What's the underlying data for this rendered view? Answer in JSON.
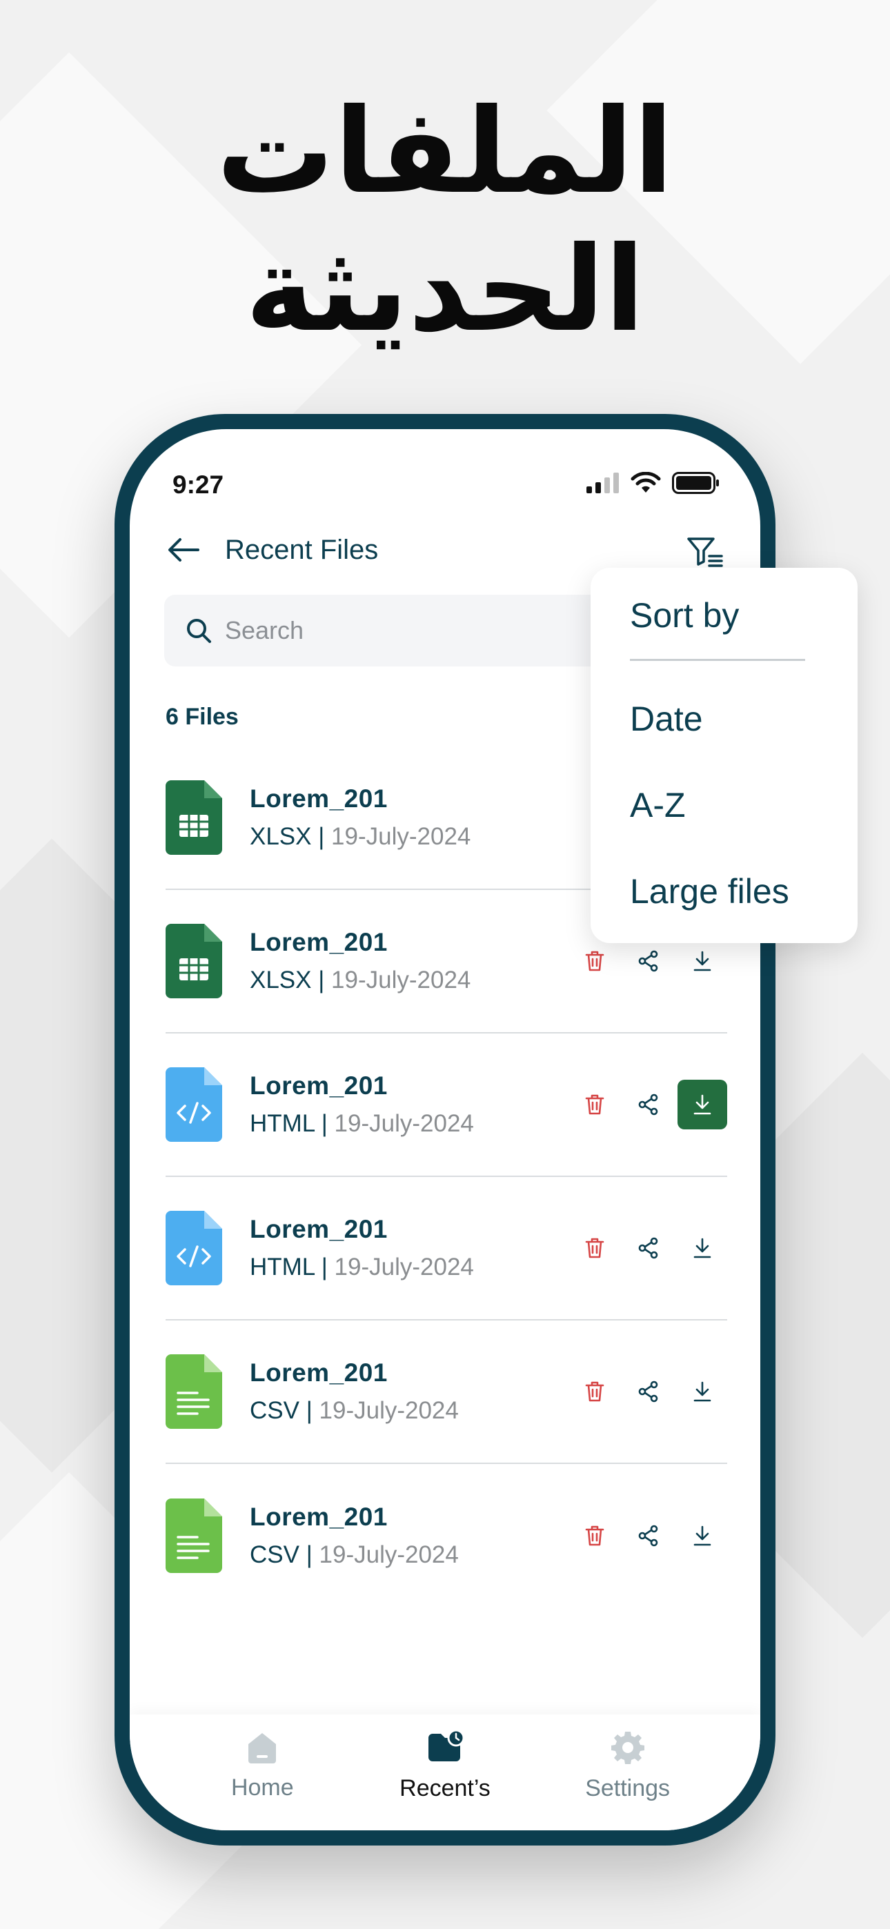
{
  "promo": {
    "headline_line1": "الملفات",
    "headline_line2": "الحديثة"
  },
  "status_bar": {
    "time": "9:27"
  },
  "header": {
    "title": "Recent Files"
  },
  "search": {
    "placeholder": "Search"
  },
  "files_count": "6 Files",
  "files": [
    {
      "name": "Lorem_201",
      "type": "XLSX",
      "separator": " | ",
      "date": "19-July-2024",
      "icon": "xlsx-file-icon",
      "color": "#217346"
    },
    {
      "name": "Lorem_201",
      "type": "XLSX",
      "separator": " | ",
      "date": "19-July-2024",
      "icon": "xlsx-file-icon",
      "color": "#217346"
    },
    {
      "name": "Lorem_201",
      "type": "HTML",
      "separator": " | ",
      "date": "19-July-2024",
      "icon": "html-file-icon",
      "color": "#4daef0"
    },
    {
      "name": "Lorem_201",
      "type": "HTML",
      "separator": " | ",
      "date": "19-July-2024",
      "icon": "html-file-icon",
      "color": "#4daef0"
    },
    {
      "name": "Lorem_201",
      "type": "CSV",
      "separator": " | ",
      "date": "19-July-2024",
      "icon": "csv-file-icon",
      "color": "#6cc04a"
    },
    {
      "name": "Lorem_201",
      "type": "CSV",
      "separator": " | ",
      "date": "19-July-2024",
      "icon": "csv-file-icon",
      "color": "#6cc04a"
    }
  ],
  "sort_menu": {
    "title": "Sort by",
    "options": [
      "Date",
      "A-Z",
      "Large files"
    ]
  },
  "bottom_nav": {
    "items": [
      {
        "label": "Home",
        "icon": "home-icon"
      },
      {
        "label": "Recent’s",
        "icon": "recent-icon",
        "active": true
      },
      {
        "label": "Settings",
        "icon": "gear-icon"
      }
    ]
  },
  "colors": {
    "brand": "#0c3e4f",
    "delete": "#d64545",
    "download_active": "#236e3f"
  }
}
